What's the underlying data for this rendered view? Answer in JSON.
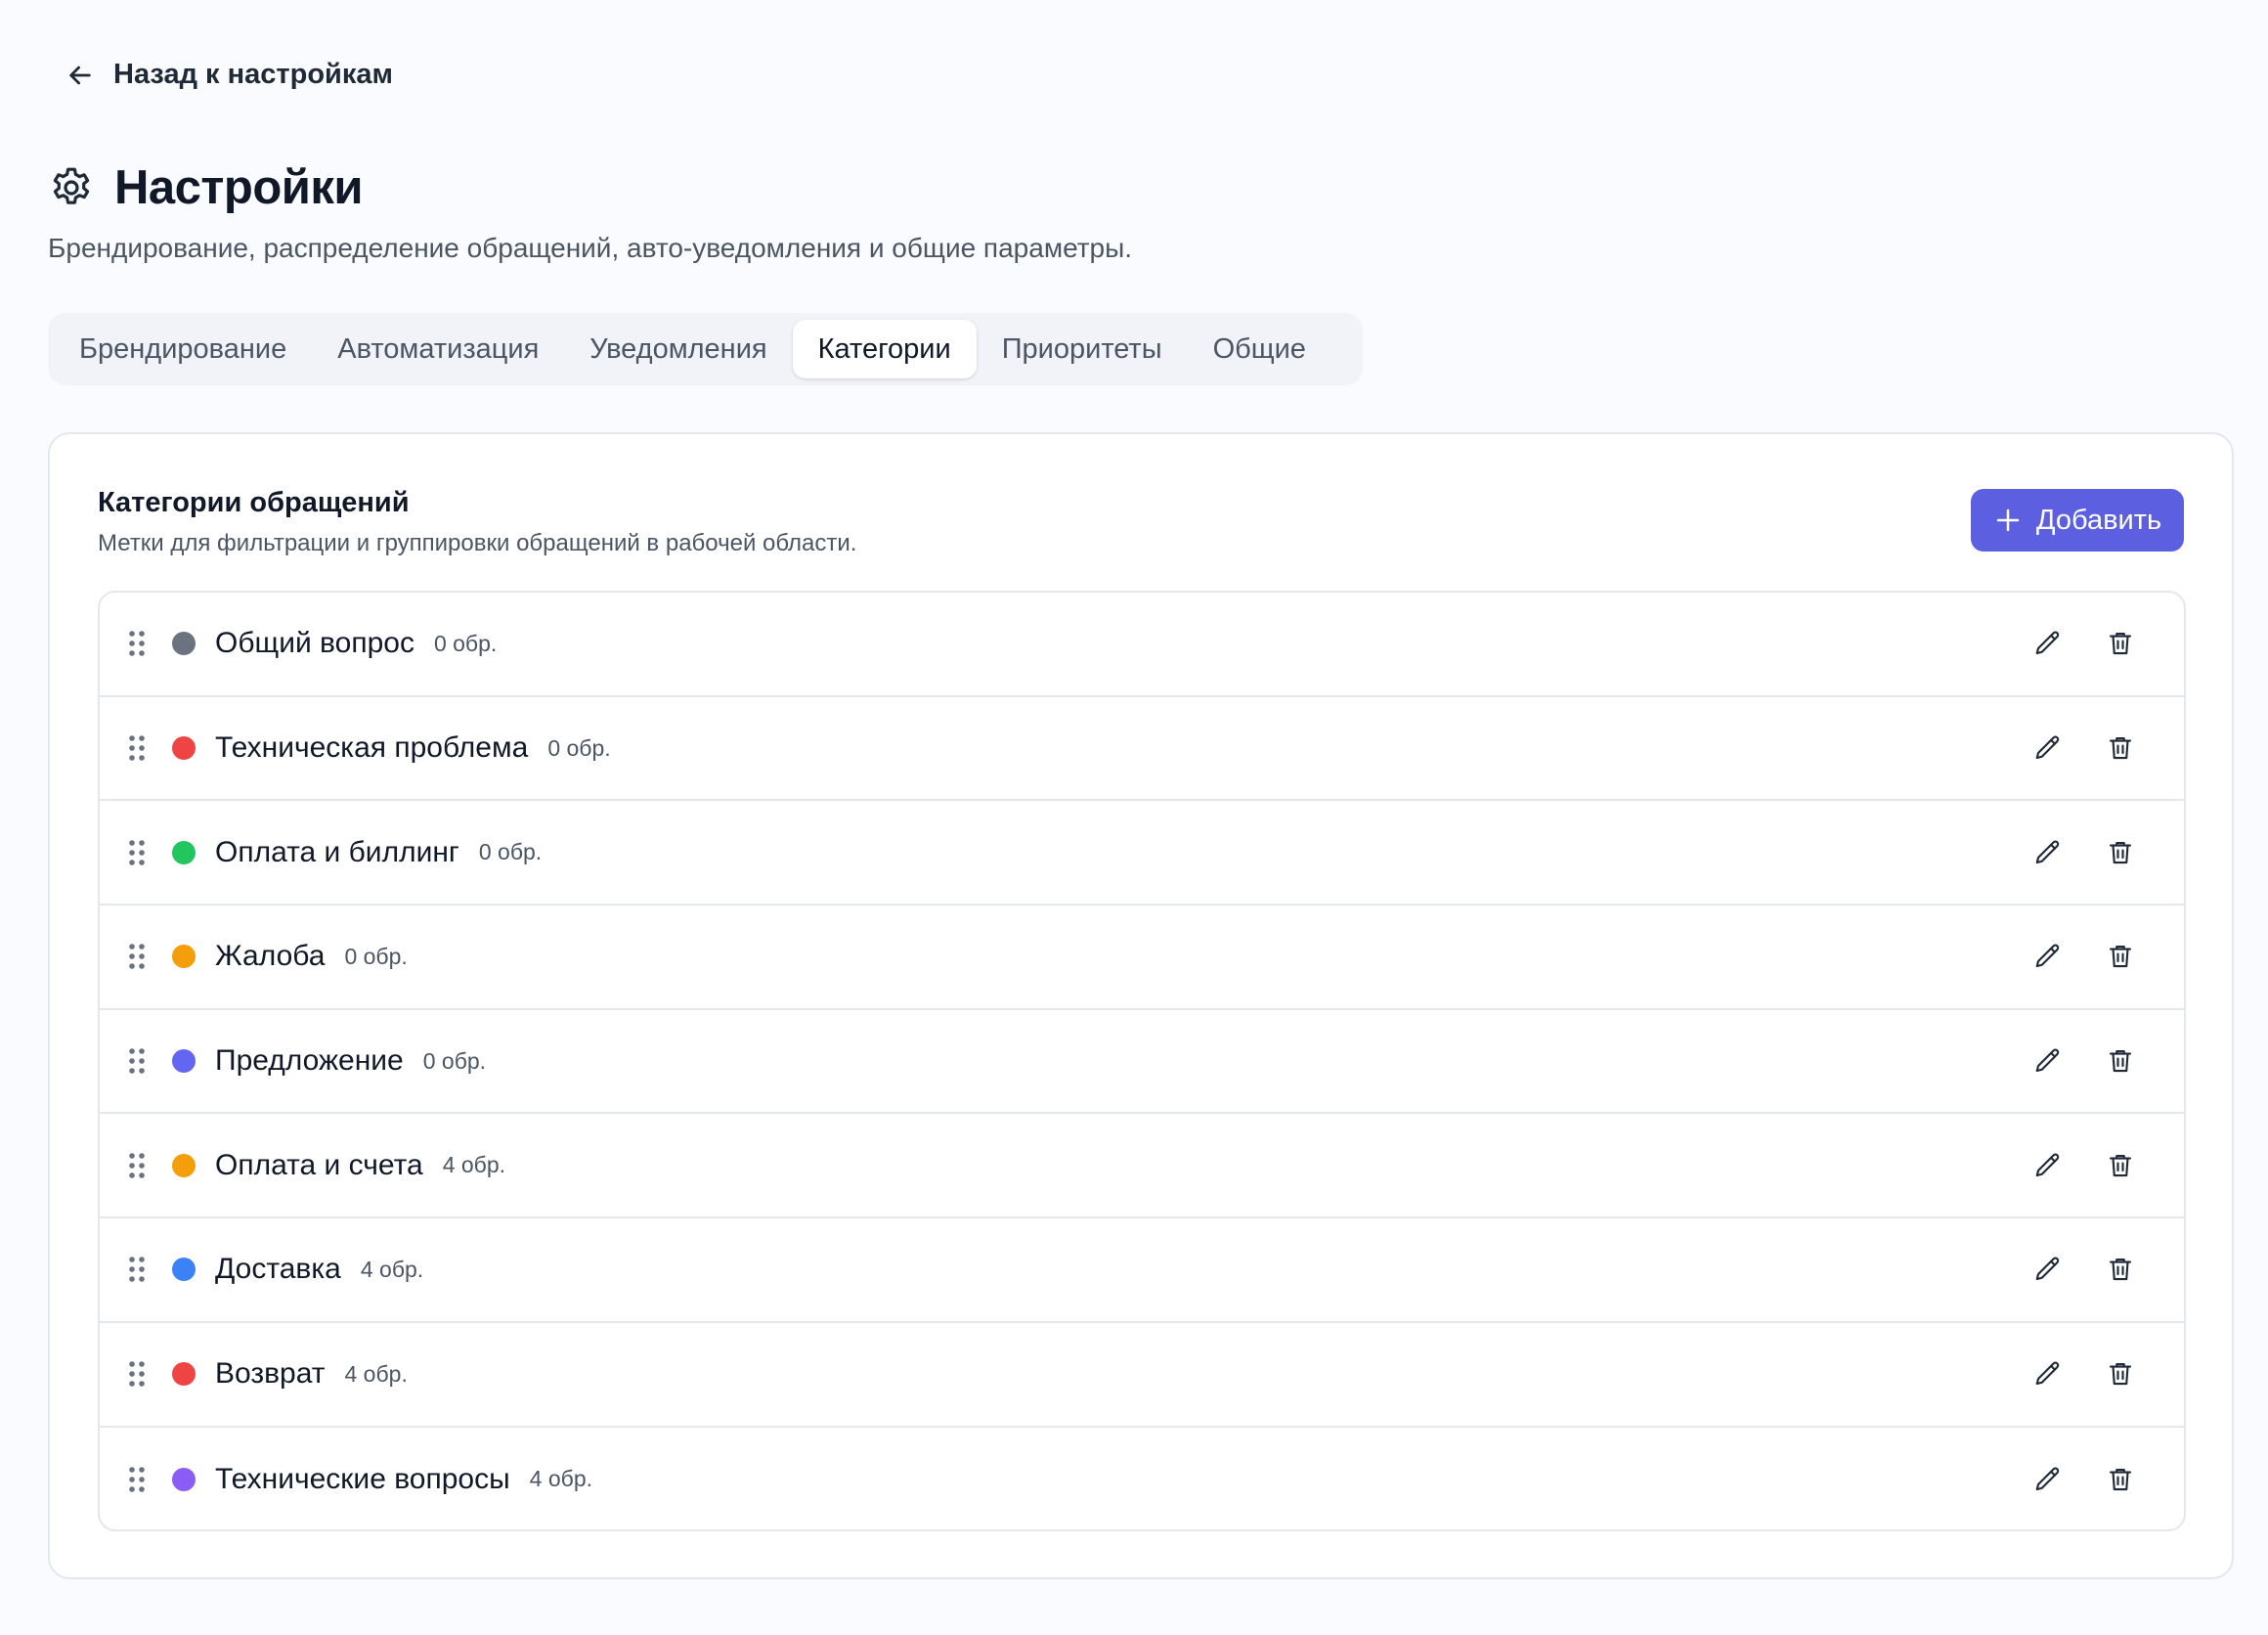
{
  "back": {
    "label": "Назад к настройкам"
  },
  "header": {
    "title": "Настройки",
    "subtitle": "Брендирование, распределение обращений, авто-уведомления и общие параметры."
  },
  "tabs": [
    {
      "label": "Брендирование",
      "active": false
    },
    {
      "label": "Автоматизация",
      "active": false
    },
    {
      "label": "Уведомления",
      "active": false
    },
    {
      "label": "Категории",
      "active": true
    },
    {
      "label": "Приоритеты",
      "active": false
    },
    {
      "label": "Общие",
      "active": false
    }
  ],
  "card": {
    "title": "Категории обращений",
    "description": "Метки для фильтрации и группировки обращений в рабочей области.",
    "add_label": "Добавить"
  },
  "categories": [
    {
      "name": "Общий вопрос",
      "count": "0 обр.",
      "color": "#6b7280"
    },
    {
      "name": "Техническая проблема",
      "count": "0 обр.",
      "color": "#ef4444"
    },
    {
      "name": "Оплата и биллинг",
      "count": "0 обр.",
      "color": "#22c55e"
    },
    {
      "name": "Жалоба",
      "count": "0 обр.",
      "color": "#f59e0b"
    },
    {
      "name": "Предложение",
      "count": "0 обр.",
      "color": "#6366f1"
    },
    {
      "name": "Оплата и счета",
      "count": "4 обр.",
      "color": "#f59e0b"
    },
    {
      "name": "Доставка",
      "count": "4 обр.",
      "color": "#3b82f6"
    },
    {
      "name": "Возврат",
      "count": "4 обр.",
      "color": "#ef4444"
    },
    {
      "name": "Технические вопросы",
      "count": "4 обр.",
      "color": "#8b5cf6"
    }
  ],
  "colors": {
    "accent": "#5b5fe0",
    "border": "#e4e7ee",
    "background": "#fafbfe"
  },
  "icons": {
    "back": "arrow-left-icon",
    "title": "gear-icon",
    "add": "plus-icon",
    "drag": "drag-handle-icon",
    "edit": "pencil-icon",
    "delete": "trash-icon"
  }
}
